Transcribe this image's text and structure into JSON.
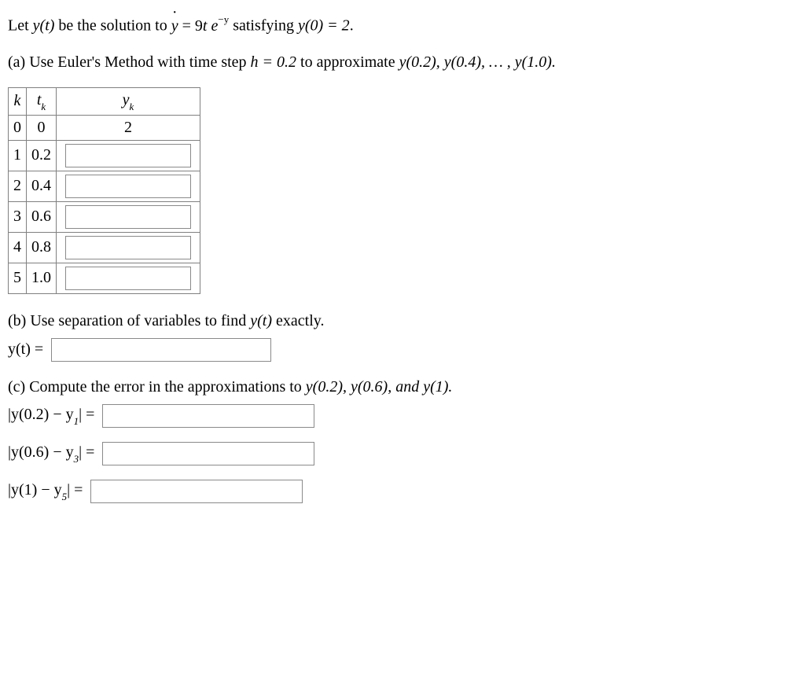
{
  "problem": {
    "intro_pre": "Let ",
    "intro_mid1": " be the solution to ",
    "intro_mid2": " satisfying ",
    "intro_end": ".",
    "yt": "y(t)",
    "ydot_eq": "ẏ = 9te",
    "exp_neg_y": "−y",
    "ic": "y(0) = 2"
  },
  "partA": {
    "label": "(a) Use Euler's Method with time step ",
    "h_eq": "h = 0.2",
    "mid": " to approximate ",
    "targets": "y(0.2),  y(0.4), … , y(1.0).",
    "table": {
      "headers": {
        "k": "k",
        "tk": "t",
        "tk_sub": "k",
        "yk": "y",
        "yk_sub": "k"
      },
      "rows": [
        {
          "k": "0",
          "tk": "0",
          "yk": "2"
        },
        {
          "k": "1",
          "tk": "0.2",
          "yk": ""
        },
        {
          "k": "2",
          "tk": "0.4",
          "yk": ""
        },
        {
          "k": "3",
          "tk": "0.6",
          "yk": ""
        },
        {
          "k": "4",
          "tk": "0.8",
          "yk": ""
        },
        {
          "k": "5",
          "tk": "1.0",
          "yk": ""
        }
      ]
    }
  },
  "partB": {
    "label": "(b) Use separation of variables to find ",
    "yt": "y(t)",
    "post": " exactly.",
    "lhs": "y(t) =",
    "value": ""
  },
  "partC": {
    "label": "(c) Compute the error in the approximations to ",
    "targets": "y(0.2),  y(0.6), and y(1).",
    "rows": [
      {
        "lhs_inner": "y(0.2) − y",
        "lhs_sub": "1",
        "eq": " = ",
        "value": ""
      },
      {
        "lhs_inner": "y(0.6) − y",
        "lhs_sub": "3",
        "eq": " = ",
        "value": ""
      },
      {
        "lhs_inner": "y(1) − y",
        "lhs_sub": "5",
        "eq": " = ",
        "value": ""
      }
    ]
  }
}
